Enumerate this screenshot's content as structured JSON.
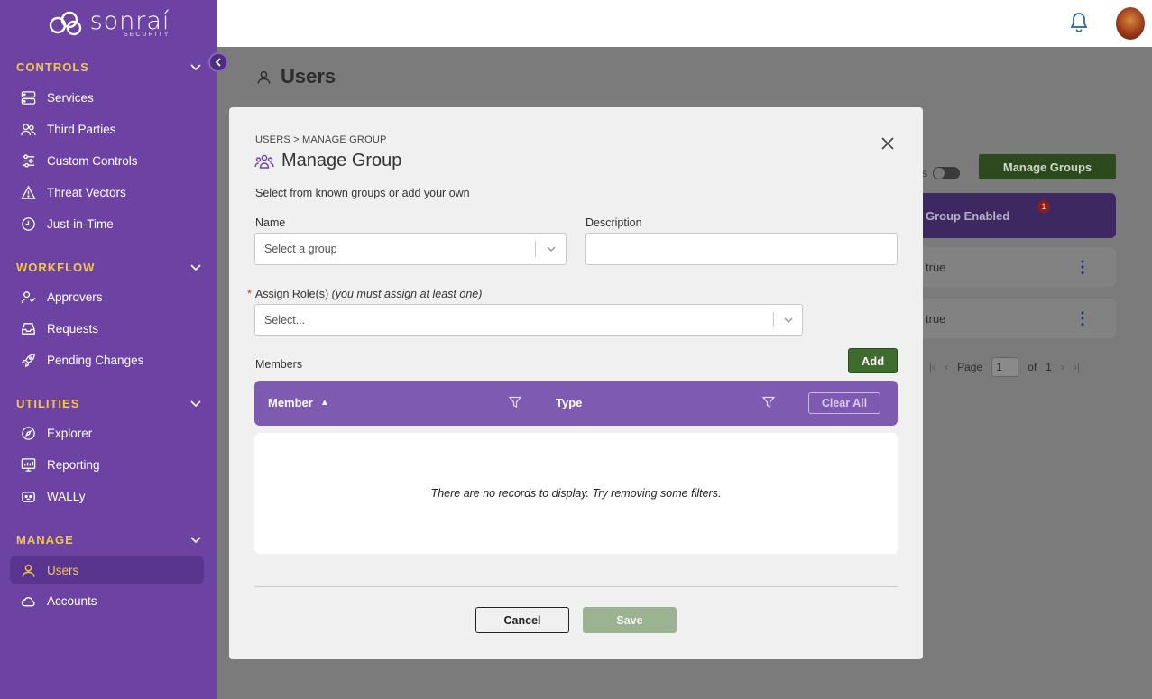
{
  "brand": {
    "name": "sonraí",
    "sub": "SECURITY"
  },
  "sidebar": {
    "sections": [
      {
        "title": "CONTROLS",
        "items": [
          {
            "label": "Services",
            "icon": "server-icon"
          },
          {
            "label": "Third Parties",
            "icon": "users-icon"
          },
          {
            "label": "Custom Controls",
            "icon": "sliders-icon"
          },
          {
            "label": "Threat Vectors",
            "icon": "warning-icon"
          },
          {
            "label": "Just-in-Time",
            "icon": "clock-icon"
          }
        ]
      },
      {
        "title": "WORKFLOW",
        "items": [
          {
            "label": "Approvers",
            "icon": "user-check-icon"
          },
          {
            "label": "Requests",
            "icon": "inbox-icon"
          },
          {
            "label": "Pending Changes",
            "icon": "rocket-icon"
          }
        ]
      },
      {
        "title": "UTILITIES",
        "items": [
          {
            "label": "Explorer",
            "icon": "compass-icon"
          },
          {
            "label": "Reporting",
            "icon": "report-icon"
          },
          {
            "label": "WALLy",
            "icon": "robot-icon"
          }
        ]
      },
      {
        "title": "MANAGE",
        "items": [
          {
            "label": "Users",
            "icon": "user-icon",
            "active": true
          },
          {
            "label": "Accounts",
            "icon": "cloud-icon"
          }
        ]
      }
    ]
  },
  "page": {
    "title": "Users",
    "toggle_label": "s",
    "manage_groups_label": "Manage Groups",
    "table_header": "Group Enabled",
    "filter_badge": "1",
    "rows": [
      {
        "value": "true"
      },
      {
        "value": "true"
      }
    ],
    "pager": {
      "page_label": "Page",
      "page_value": "1",
      "of_label": "of",
      "total": "1"
    }
  },
  "modal": {
    "breadcrumb": "USERS > MANAGE GROUP",
    "title": "Manage Group",
    "subtitle": "Select from known groups or add your own",
    "name_label": "Name",
    "name_placeholder": "Select a group",
    "description_label": "Description",
    "description_value": "",
    "roles_label": "Assign Role(s)",
    "roles_note": "(you must assign at least one)",
    "roles_placeholder": "Select...",
    "members_label": "Members",
    "add_label": "Add",
    "columns": [
      {
        "label": "Member",
        "sorted": "asc"
      },
      {
        "label": "Type"
      }
    ],
    "clear_all_label": "Clear All",
    "empty_message": "There are no records to display. Try removing some filters.",
    "cancel_label": "Cancel",
    "save_label": "Save"
  },
  "colors": {
    "sidebar": "#6c43a3",
    "accent_yellow": "#f3c74b",
    "primary_green": "#3f6b2c",
    "table_header": "#7e5bb0"
  }
}
